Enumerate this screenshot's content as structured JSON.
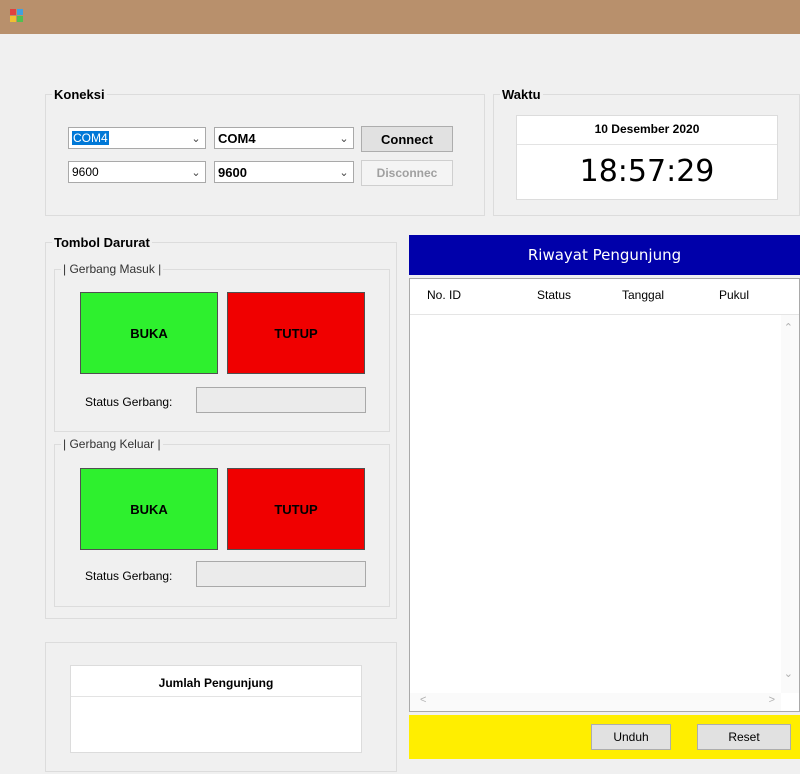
{
  "colors": {
    "titlebar": "#b8906c",
    "green": "#2ef02e",
    "red": "#f00000",
    "blue": "#0000aa",
    "yellow": "#ffee00"
  },
  "koneksi": {
    "title": "Koneksi",
    "port_selected": "COM4",
    "port_value": "COM4",
    "baud_selected": "9600",
    "baud_value": "9600",
    "connect_label": "Connect",
    "disconnect_label": "Disconnec"
  },
  "waktu": {
    "title": "Waktu",
    "date": "10 Desember 2020",
    "time": "18:57:29"
  },
  "darurat": {
    "title": "Tombol Darurat",
    "masuk": {
      "title": "| Gerbang Masuk |",
      "buka": "BUKA",
      "tutup": "TUTUP",
      "status_label": "Status Gerbang:",
      "status_value": ""
    },
    "keluar": {
      "title": "| Gerbang Keluar |",
      "buka": "BUKA",
      "tutup": "TUTUP",
      "status_label": "Status Gerbang:",
      "status_value": ""
    }
  },
  "jumlah": {
    "title": "Jumlah Pengunjung",
    "value": ""
  },
  "riwayat": {
    "title": "Riwayat Pengunjung",
    "columns": [
      "No. ID",
      "Status",
      "Tanggal",
      "Pukul"
    ],
    "rows": []
  },
  "actions": {
    "unduh": "Unduh",
    "reset": "Reset"
  },
  "icons": {
    "app": "app-window-icon",
    "combo": "chevron-down-icon"
  }
}
